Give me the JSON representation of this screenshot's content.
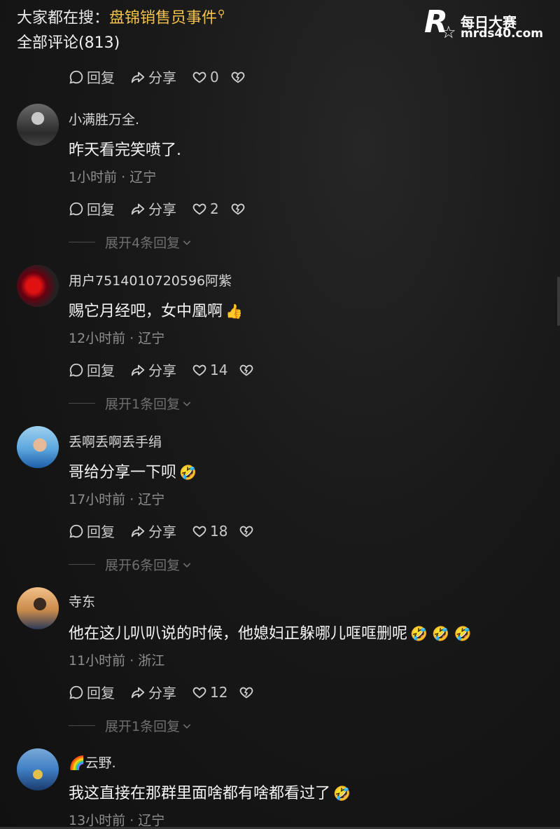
{
  "header": {
    "search_prefix": "大家都在搜：",
    "search_topic": "盘锦销售员事件",
    "comments_label": "全部评论(813)"
  },
  "watermark": {
    "logo_letter": "R",
    "logo_sub": "每日大赛",
    "title": "每日大赛",
    "url": "mrds40.com"
  },
  "labels": {
    "reply": "回复",
    "share": "分享"
  },
  "top_actions": {
    "likes": "0"
  },
  "comments": [
    {
      "user": "小满胜万全.",
      "text": "昨天看完笑喷了.",
      "meta": "1小时前 · 辽宁",
      "likes": "2",
      "expand": "展开4条回复",
      "emoji": ""
    },
    {
      "user": "用户7514010720596阿紫",
      "text": "赐它月经吧，女中凰啊",
      "meta": "12小时前 · 辽宁",
      "likes": "14",
      "expand": "展开1条回复",
      "emoji": "👍"
    },
    {
      "user": "丢啊丢啊丢手绢",
      "text": "哥给分享一下呗",
      "meta": "17小时前 · 辽宁",
      "likes": "18",
      "expand": "展开6条回复",
      "emoji": "🤣"
    },
    {
      "user": "寺东",
      "text": "他在这儿叭叭说的时候，他媳妇正躲哪儿哐哐删呢",
      "meta": "11小时前 · 浙江",
      "likes": "12",
      "expand": "展开1条回复",
      "emoji": "🤣 🤣 🤣"
    },
    {
      "user": "🌈云野.",
      "text": "我这直接在那群里面啥都有啥都看过了",
      "meta": "13小时前 · 辽宁",
      "emoji": "🤣"
    }
  ],
  "icons": {
    "search": "search-icon",
    "reply": "comment-bubble-icon",
    "share": "share-arrow-icon",
    "like": "heart-icon",
    "dislike": "broken-heart-icon",
    "expand": "chevron-down-icon"
  },
  "colors": {
    "accent": "#f3c24d",
    "background": "#161616"
  }
}
